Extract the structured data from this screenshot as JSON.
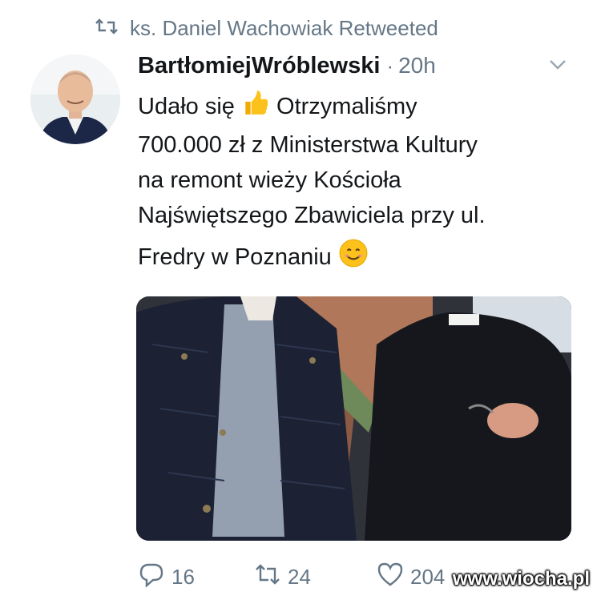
{
  "retweet": {
    "icon": "retweet-icon",
    "text": "ks. Daniel Wachowiak Retweeted"
  },
  "tweet": {
    "author_name": "BartłomiejWróblewski",
    "separator": "·",
    "time": "20h",
    "text_lines": [
      "Udało się",
      "Otrzymaliśmy",
      "700.000 zł z Ministerstwa Kultury",
      "na remont wieży Kościoła",
      "Najświętszego Zbawiciela przy ul.",
      "Fredry w Poznaniu"
    ],
    "emojis": [
      "thumbs-up-emoji",
      "smiling-face-emoji"
    ]
  },
  "actions": {
    "replies": "16",
    "retweets": "24",
    "likes": "204"
  },
  "watermark": "www.wiocha.pl",
  "colors": {
    "secondary_text": "#657786",
    "primary_text": "#14171a"
  }
}
